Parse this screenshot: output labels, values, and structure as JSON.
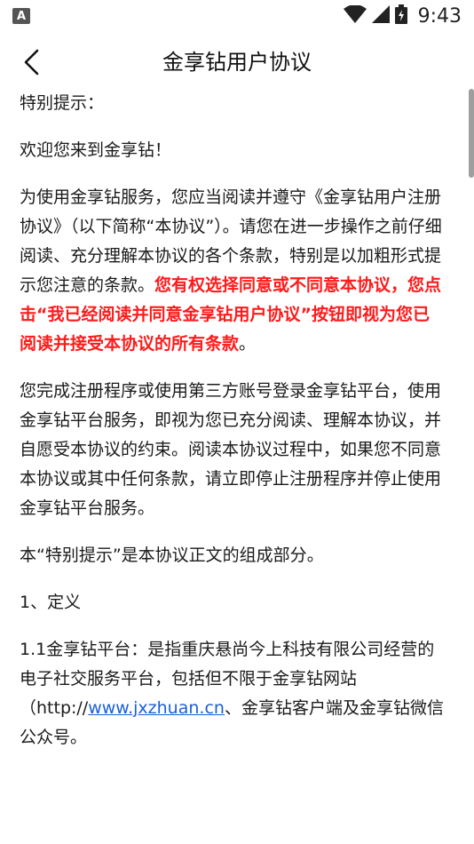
{
  "status_bar": {
    "app_icon": "A",
    "time": "9:43",
    "icons": [
      "wifi-icon",
      "signal-icon",
      "battery-icon"
    ]
  },
  "header": {
    "title": "金享钻用户协议",
    "back_icon": "chevron-left-icon"
  },
  "colors": {
    "emphasis": "#ff1a1a",
    "link": "#1a5fd8",
    "text": "#1a1a1a"
  },
  "content": {
    "p1": "特别提示：",
    "p2": "欢迎您来到金享钻！",
    "p3_normal": "为使用金享钻服务，您应当阅读并遵守《金享钻用户注册协议》（以下简称“本协议”）。请您在进一步操作之前仔细阅读、充分理解本协议的各个条款，特别是以加粗形式提示您注意的条款。",
    "p3_bold": "您有权选择同意或不同意本协议，您点击“我已经阅读并同意金享钻用户协议”按钮即视为您已阅读并接受本协议的所有条款",
    "p3_end": "。",
    "p4": "您完成注册程序或使用第三方账号登录金享钻平台，使用金享钻平台服务，即视为您已充分阅读、理解本协议，并自愿受本协议的约束。阅读本协议过程中，如果您不同意本协议或其中任何条款，请立即停止注册程序并停止使用金享钻平台服务。",
    "p5": "本“特别提示”是本协议正文的组成部分。",
    "p6": "1、定义",
    "p7_a": "1.1金享钻平台：是指重庆悬尚今上科技有限公司经营的电子社交服务平台，包括但不限于金享钻网站（http://",
    "p7_link": "www.jxzhuan.cn",
    "p7_b": "、金享钻客户端及金享钻微信公众号。"
  }
}
